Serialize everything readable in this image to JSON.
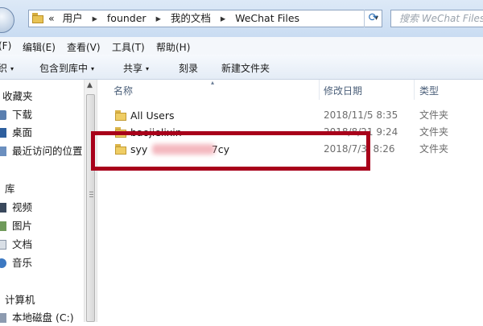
{
  "address": {
    "prefix": "«",
    "crumbs": [
      "用户",
      "founder",
      "我的文档",
      "WeChat Files"
    ],
    "separator": "▸",
    "dropdown": "▾",
    "refresh_icon": "refresh-icon",
    "search_placeholder": "搜索 WeChat Files"
  },
  "menu": {
    "items": [
      "(F)",
      "编辑(E)",
      "查看(V)",
      "工具(T)",
      "帮助(H)"
    ]
  },
  "command_bar": {
    "organize": "织",
    "organize_arrow": "▾",
    "include_in_library": "包含到库中",
    "include_arrow": "▾",
    "share": "共享",
    "share_arrow": "▾",
    "burn": "刻录",
    "new_folder": "新建文件夹"
  },
  "nav": {
    "favorites": "收藏夹",
    "downloads": "下载",
    "desktop": "桌面",
    "recent": "最近访问的位置",
    "libraries": "库",
    "videos": "视频",
    "pictures": "图片",
    "documents": "文档",
    "music": "音乐",
    "computer": "计算机",
    "local_disk": "本地磁盘 (C:)"
  },
  "columns": {
    "name": "名称",
    "date_modified": "修改日期",
    "type": "类型",
    "sort_arrow": "▴"
  },
  "files": [
    {
      "name": "All Users",
      "date": "2018/11/5 8:35",
      "type": "文件夹"
    },
    {
      "name": "baojielixin",
      "date": "2018/8/21 9:24",
      "type": "文件夹"
    },
    {
      "name": "syy                    7cy",
      "date": "2018/7/3  8:26",
      "type": "文件夹"
    }
  ],
  "highlight_color": "#a8001a"
}
